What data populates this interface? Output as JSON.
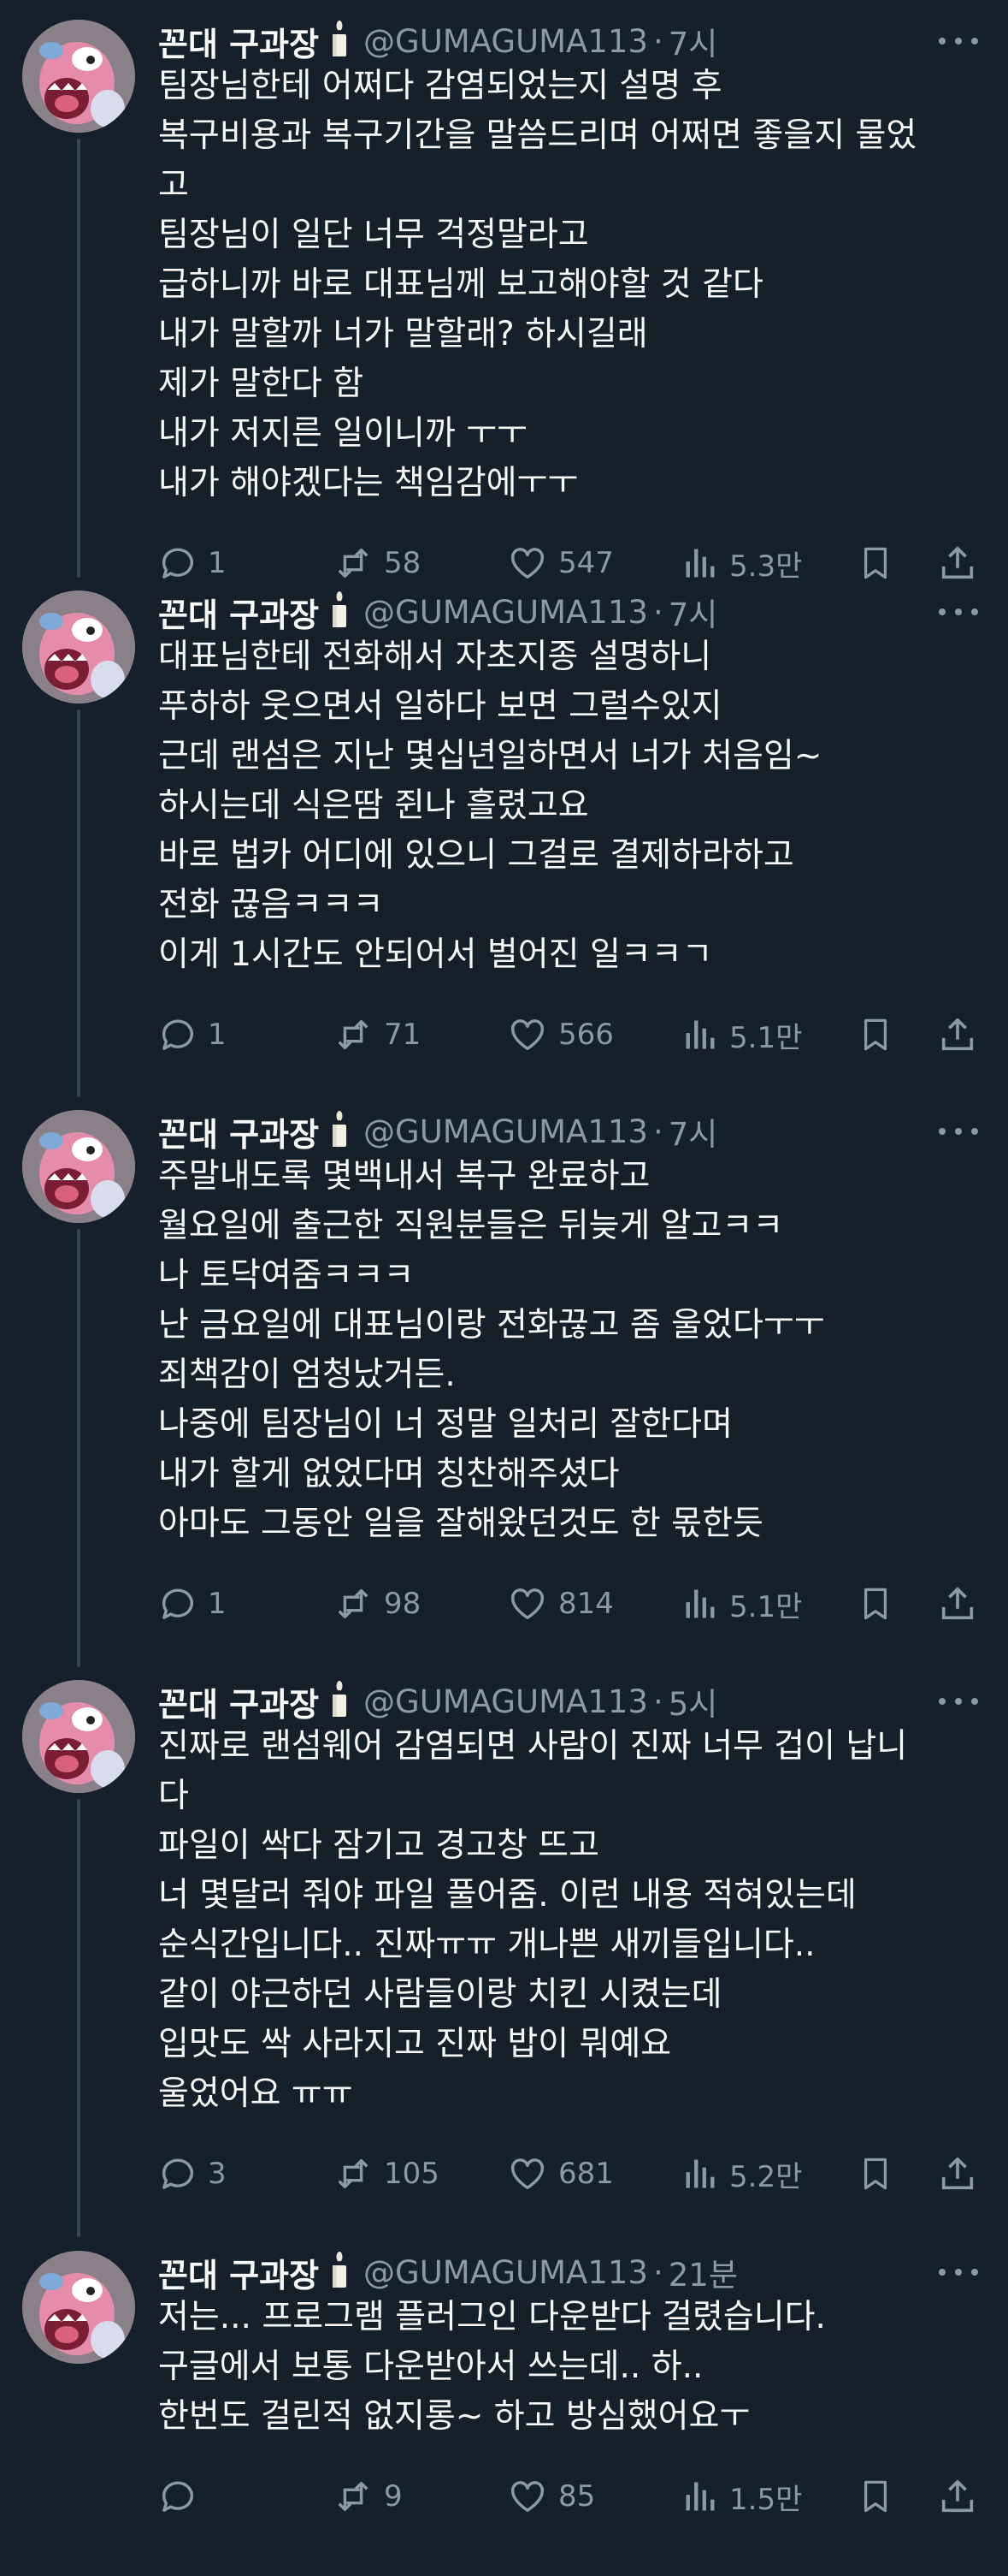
{
  "colors": {
    "background": "#15202b",
    "text": "#f7f9f9",
    "secondary": "#8b98a5",
    "thread_line": "#38444d"
  },
  "tweets": [
    {
      "name": "꼰대 구과장",
      "handle": "@GUMAGUMA113",
      "time": "7시",
      "lines": [
        "팀장님한테 어쩌다 감염되었는지 설명 후",
        "복구비용과 복구기간을 말씀드리며 어쩌면 좋을지 물었",
        "고",
        "팀장님이 일단 너무 걱정말라고",
        "급하니까 바로 대표님께 보고해야할 것 같다",
        "내가 말할까 너가 말할래? 하시길래",
        "제가 말한다 함",
        "내가 저지른 일이니까 ㅜㅜ",
        "내가 해야겠다는 책임감에ㅜㅜ"
      ],
      "replies": "1",
      "retweets": "58",
      "likes": "547",
      "views": "5.3만"
    },
    {
      "name": "꼰대 구과장",
      "handle": "@GUMAGUMA113",
      "time": "7시",
      "lines": [
        "대표님한테 전화해서 자초지종 설명하니",
        "푸하하 웃으면서 일하다 보면 그럴수있지",
        "근데 랜섬은 지난 몇십년일하면서 너가 처음임~",
        "하시는데 식은땀 쥔나 흘렸고요",
        "바로 법카 어디에 있으니 그걸로 결제하라하고",
        "전화 끊음ㅋㅋㅋ",
        "이게 1시간도 안되어서 벌어진 일ㅋㅋㄱ"
      ],
      "replies": "1",
      "retweets": "71",
      "likes": "566",
      "views": "5.1만"
    },
    {
      "name": "꼰대 구과장",
      "handle": "@GUMAGUMA113",
      "time": "7시",
      "lines": [
        "주말내도록 몇백내서 복구 완료하고",
        "월요일에 출근한 직원분들은 뒤늦게 알고ㅋㅋ",
        "나 토닥여줌ㅋㅋㅋ",
        "난 금요일에 대표님이랑 전화끊고 좀 울었다ㅜㅜ",
        "죄책감이 엄청났거든.",
        "나중에 팀장님이 너 정말 일처리 잘한다며",
        "내가 할게 없었다며 칭찬해주셨다",
        "아마도 그동안 일을 잘해왔던것도 한 몫한듯"
      ],
      "replies": "1",
      "retweets": "98",
      "likes": "814",
      "views": "5.1만"
    },
    {
      "name": "꼰대 구과장",
      "handle": "@GUMAGUMA113",
      "time": "5시",
      "lines": [
        "진짜로 랜섬웨어 감염되면 사람이 진짜 너무 겁이 납니",
        "다",
        "파일이 싹다 잠기고 경고창 뜨고",
        "너 몇달러 줘야 파일 풀어줌. 이런 내용 적혀있는데",
        "순식간입니다.. 진짜ㅠㅠ 개나쁜 새끼들입니다..",
        "같이 야근하던 사람들이랑 치킨 시켰는데",
        "입맛도 싹 사라지고 진짜 밥이 뭐예요",
        "울었어요 ㅠㅠ"
      ],
      "replies": "3",
      "retweets": "105",
      "likes": "681",
      "views": "5.2만"
    },
    {
      "name": "꼰대 구과장",
      "handle": "@GUMAGUMA113",
      "time": "21분",
      "lines": [
        "저는... 프로그램 플러그인 다운받다 걸렸습니다.",
        "구글에서 보통 다운받아서 쓰는데.. 하..",
        "한번도 걸린적 없지롱~ 하고 방심했어요ㅜ"
      ],
      "replies": "",
      "retweets": "9",
      "likes": "85",
      "views": "1.5만"
    }
  ]
}
